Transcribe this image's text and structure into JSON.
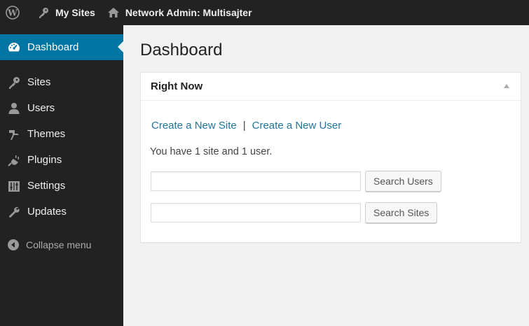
{
  "adminbar": {
    "my_sites": "My Sites",
    "network_admin": "Network Admin: Multisajter"
  },
  "sidebar": {
    "items": [
      {
        "label": "Dashboard",
        "icon": "dashboard-icon",
        "current": true
      },
      {
        "label": "Sites",
        "icon": "key-icon"
      },
      {
        "label": "Users",
        "icon": "user-icon"
      },
      {
        "label": "Themes",
        "icon": "brush-icon"
      },
      {
        "label": "Plugins",
        "icon": "plug-icon"
      },
      {
        "label": "Settings",
        "icon": "settings-icon"
      },
      {
        "label": "Updates",
        "icon": "wrench-icon"
      }
    ],
    "collapse": "Collapse menu"
  },
  "main": {
    "title": "Dashboard",
    "box": {
      "title": "Right Now",
      "create_site": "Create a New Site",
      "separator": "|",
      "create_user": "Create a New User",
      "summary": "You have 1 site and 1 user.",
      "search_users_value": "",
      "search_users_button": "Search Users",
      "search_sites_value": "",
      "search_sites_button": "Search Sites"
    }
  },
  "colors": {
    "adminbar_bg": "#222222",
    "sidebar_bg": "#222222",
    "current_item_bg": "#0074a2",
    "link": "#21759b",
    "content_bg": "#f1f1f1"
  }
}
